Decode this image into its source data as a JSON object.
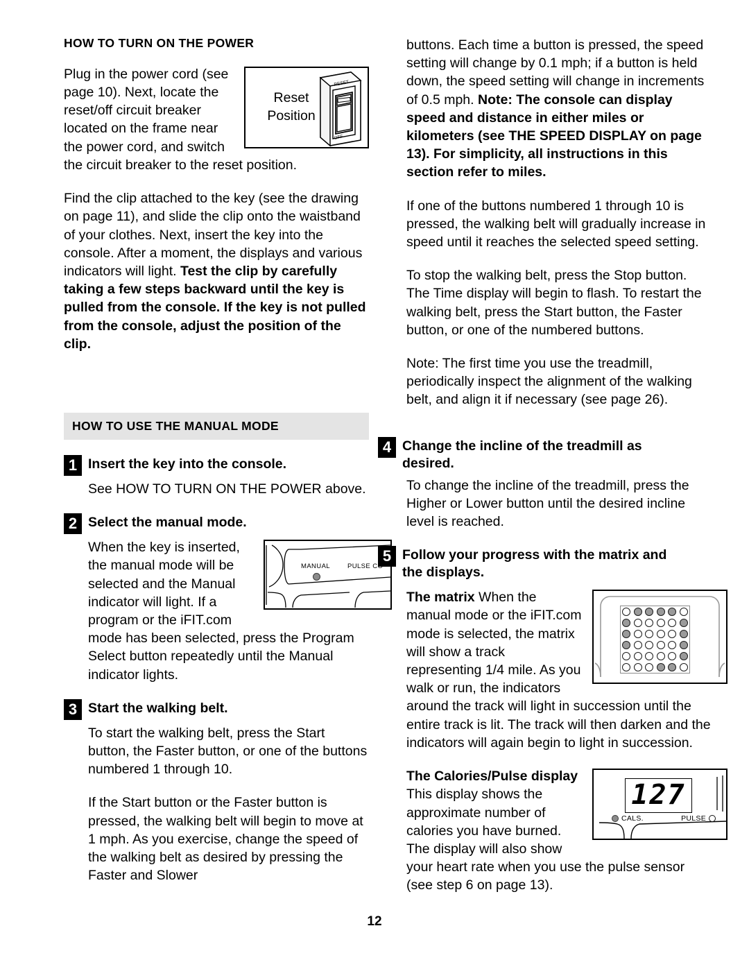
{
  "page": {
    "number": "12"
  },
  "left_column": {
    "section1": {
      "title": "HOW TO TURN ON THE POWER",
      "paragraph1": "Plug in the power cord (see page 10). Next, locate the reset/off circuit breaker located on the frame near the power cord, and switch the circuit breaker to the reset position.",
      "paragraph2_normal": "Find the clip attached to the key (see the drawing on page 11), and slide the clip onto the waistband of your clothes. Next, insert the key into the console. After a moment, the displays and various indicators will light. ",
      "paragraph2_bold": "Test the clip by carefully taking a few steps backward until the key is pulled from the console. If the key is not pulled from the console, adjust the position of the clip.",
      "figure": {
        "caption_line1": "Reset",
        "caption_line2": "Position",
        "switch_top_label": "RESET",
        "switch_bottom_label": "OFF"
      }
    },
    "section2": {
      "title": "HOW TO USE THE MANUAL MODE",
      "steps": [
        {
          "number": "1",
          "title": "Insert the key into the console.",
          "body": "See HOW TO TURN ON THE POWER above."
        },
        {
          "number": "2",
          "title": "Select the manual mode.",
          "body": "When the key is inserted, the manual mode will be selected and the Manual indicator will light. If a program or the iFIT.com mode has been selected, press the Program Select button repeatedly until the Manual indicator lights.",
          "figure": {
            "label_manual": "MANUAL",
            "label_pulse": "PULSE CO"
          }
        },
        {
          "number": "3",
          "title": "Start the walking belt.",
          "body1": "To start the walking belt, press the Start button, the Faster button, or one of the buttons numbered 1 through 10.",
          "body2": "If the Start button or the Faster button is pressed, the walking belt will begin to move at 1 mph. As you exercise, change the speed of the walking belt as desired by pressing the Faster and Slower"
        }
      ]
    }
  },
  "right_column": {
    "paragraph1_normal": "buttons. Each time a button is pressed, the speed setting will change by 0.1 mph; if a button is held down, the speed setting will change in increments of 0.5 mph. ",
    "paragraph1_bold": "Note: The console can display speed and distance in either miles or kilometers (see THE SPEED DISPLAY on page 13). For simplicity, all instructions in this section refer to miles.",
    "paragraph2": "If one of the buttons numbered 1 through 10 is pressed, the walking belt will gradually increase in speed until it reaches the selected speed setting.",
    "paragraph3": "To stop the walking belt, press the Stop button. The Time display will begin to flash. To restart the walking belt, press the Start button, the Faster button, or one of the numbered buttons.",
    "paragraph4": "Note: The first time you use the treadmill, periodically inspect the alignment of the walking belt, and align it if necessary (see page 26).",
    "steps": [
      {
        "number": "4",
        "title": "Change the incline of the treadmill as desired.",
        "body": "To change the incline of the treadmill, press the Higher or Lower button until the desired incline level is reached."
      },
      {
        "number": "5",
        "title": "Follow your progress with the matrix and the displays.",
        "matrix_para_bold": "The matrix ",
        "matrix_para_normal": "When the manual mode or the iFIT.com mode is selected, the matrix will show a track representing 1/4 mile. As you walk or run, the indicators around the track will light in succession until the entire track is lit. The track will then darken and the indicators will again begin to light in succession.",
        "calories_para_bold1": "The Calories/Pulse display ",
        "calories_para_normal": "This display shows the approximate number of calories you have burned. The display will also show your heart rate when you use the pulse sensor (see step 6 on page 13).",
        "matrix_figure": {
          "rows": [
            [
              0,
              1,
              1,
              1,
              1,
              0
            ],
            [
              1,
              0,
              0,
              0,
              0,
              1
            ],
            [
              1,
              0,
              0,
              0,
              0,
              1
            ],
            [
              1,
              0,
              0,
              0,
              0,
              1
            ],
            [
              0,
              0,
              0,
              0,
              0,
              1
            ],
            [
              0,
              0,
              0,
              1,
              1,
              0
            ]
          ]
        },
        "calories_figure": {
          "lcd_value": "127",
          "label_cals": "CALS.",
          "label_pulse": "PULSE"
        }
      }
    ]
  },
  "colors": {
    "band_gray": "#e4e4e4",
    "badge_black": "#000000",
    "indicator_gray": "#8b8b8b",
    "text": "#000000"
  }
}
